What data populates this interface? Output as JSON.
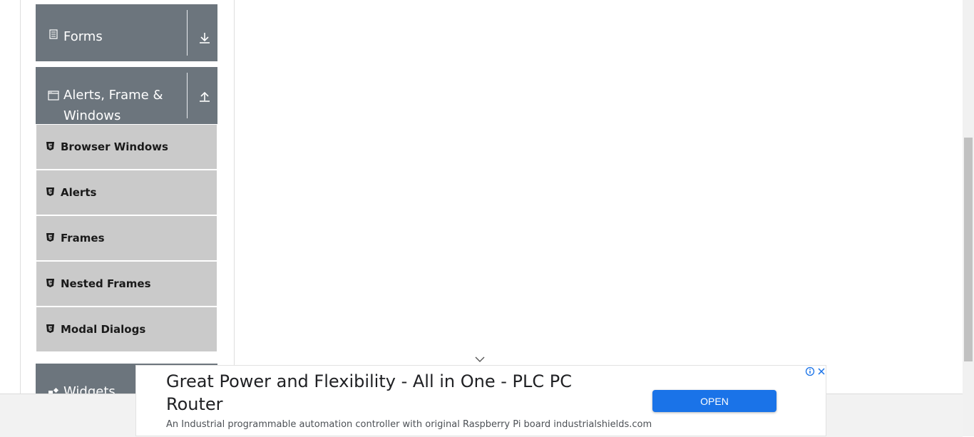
{
  "sidebar": {
    "groups": [
      {
        "label": "Forms",
        "icon": "form-icon",
        "toggle_icon": "download-arrow-icon",
        "expanded": false
      },
      {
        "label": "Alerts, Frame & Windows",
        "icon": "window-icon",
        "toggle_icon": "upload-arrow-icon",
        "expanded": true,
        "items": [
          {
            "label": "Browser Windows",
            "icon": "html5-icon"
          },
          {
            "label": "Alerts",
            "icon": "html5-icon"
          },
          {
            "label": "Frames",
            "icon": "html5-icon"
          },
          {
            "label": "Nested Frames",
            "icon": "html5-icon"
          },
          {
            "label": "Modal Dialogs",
            "icon": "html5-icon"
          }
        ]
      },
      {
        "label": "Widgets",
        "icon": "widgets-icon",
        "expanded": false
      }
    ]
  },
  "ad": {
    "headline": "Great Power and Flexibility - All in One - PLC PC Router",
    "description": "An Industrial programmable automation controller with original Raspberry Pi board industrialshields.com",
    "cta_label": "OPEN",
    "cta_color": "#1a73e8"
  },
  "colors": {
    "group_header_bg": "#6c757d",
    "menu_item_bg": "#cacaca"
  }
}
